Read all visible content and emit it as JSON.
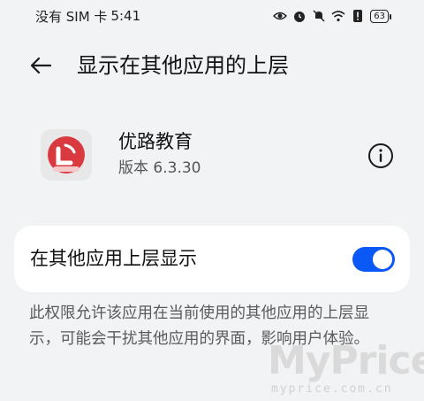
{
  "status_bar": {
    "carrier": "没有 SIM 卡",
    "time": "5:41",
    "battery": "63",
    "icons": [
      "eye-icon",
      "alarm-icon",
      "mute-icon",
      "wifi-icon",
      "alert-icon",
      "battery-icon"
    ]
  },
  "header": {
    "title": "显示在其他应用的上层",
    "back_icon": "arrow-left-icon"
  },
  "app": {
    "name": "优路教育",
    "version": "版本 6.3.30",
    "info_icon": "info-icon",
    "brand_color": "#d93a3f"
  },
  "setting": {
    "label": "在其他应用上层显示",
    "enabled": true,
    "accent_color": "#0a59f7"
  },
  "description": "此权限允许该应用在当前使用的其他应用的上层显示，可能会干扰其他应用的界面，影响用户体验。",
  "watermark": {
    "text": "MyPrice",
    "url": "myprice.com.cn"
  }
}
